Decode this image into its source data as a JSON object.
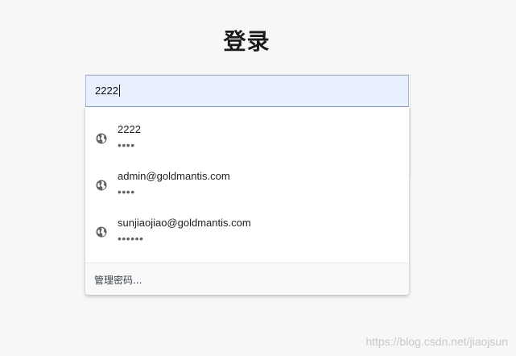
{
  "page": {
    "title": "登录"
  },
  "login": {
    "username_value": "2222"
  },
  "autofill": {
    "suggestions": [
      {
        "username": "2222",
        "password_mask": "••••",
        "icon": "globe-icon"
      },
      {
        "username": "admin@goldmantis.com",
        "password_mask": "••••",
        "icon": "globe-icon"
      },
      {
        "username": "sunjiaojiao@goldmantis.com",
        "password_mask": "••••••",
        "icon": "globe-icon"
      }
    ],
    "manage_label": "管理密码..."
  },
  "watermark": "https://blog.csdn.net/jiaojsun",
  "colors": {
    "input_autofill_bg": "#e8f0fe",
    "page_bg": "#f7f7f7",
    "icon": "#5f6368"
  }
}
